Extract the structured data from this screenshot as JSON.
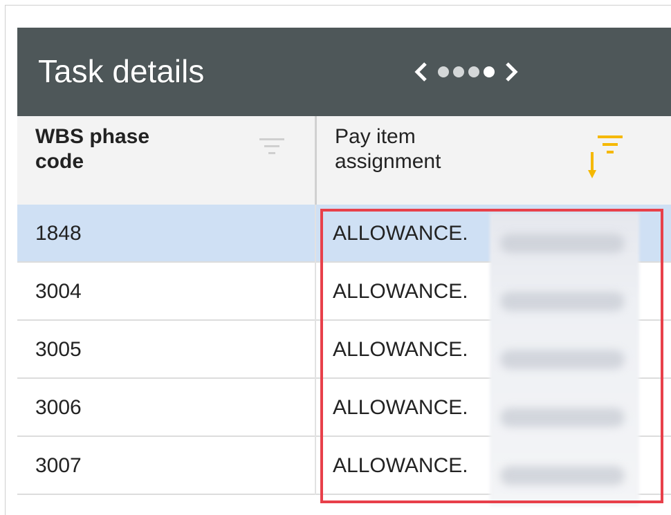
{
  "panel": {
    "title": "Task details",
    "pager": {
      "prev_icon": "chevron-left-icon",
      "next_icon": "chevron-right-icon",
      "dot_count": 4,
      "active_dot": 4
    }
  },
  "table": {
    "columns": [
      {
        "label": "WBS phase\ncode",
        "filter_icon": "filter-icon",
        "filter_active": false
      },
      {
        "label": "Pay item\nassignment",
        "filter_icon": "sort-filter-icon",
        "filter_active": true
      }
    ],
    "rows": [
      {
        "wbs": "1848",
        "pay_item": "ALLOWANCE.",
        "selected": true
      },
      {
        "wbs": "3004",
        "pay_item": "ALLOWANCE.",
        "selected": false
      },
      {
        "wbs": "3005",
        "pay_item": "ALLOWANCE.",
        "selected": false
      },
      {
        "wbs": "3006",
        "pay_item": "ALLOWANCE.",
        "selected": false
      },
      {
        "wbs": "3007",
        "pay_item": "ALLOWANCE.",
        "selected": false
      }
    ]
  },
  "colors": {
    "titlebar": "#4e5759",
    "selected_row": "#cfe0f4",
    "highlight_border": "#e8404a",
    "active_filter": "#f5b800"
  }
}
